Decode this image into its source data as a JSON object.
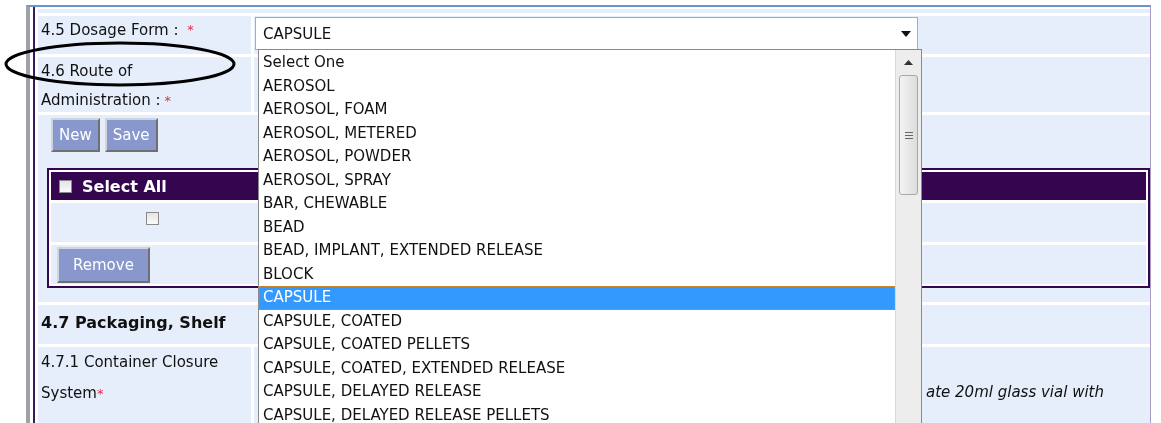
{
  "dosage_form": {
    "label": "4.5 Dosage Form :",
    "required_mark": "*",
    "value": "CAPSULE",
    "expanded": true,
    "options": [
      {
        "label": "Select One",
        "selected": false
      },
      {
        "label": "AEROSOL",
        "selected": false
      },
      {
        "label": "AEROSOL, FOAM",
        "selected": false
      },
      {
        "label": "AEROSOL, METERED",
        "selected": false
      },
      {
        "label": "AEROSOL, POWDER",
        "selected": false
      },
      {
        "label": "AEROSOL, SPRAY",
        "selected": false
      },
      {
        "label": "BAR, CHEWABLE",
        "selected": false
      },
      {
        "label": "BEAD",
        "selected": false
      },
      {
        "label": "BEAD, IMPLANT, EXTENDED RELEASE",
        "selected": false
      },
      {
        "label": "BLOCK",
        "selected": false
      },
      {
        "label": "CAPSULE",
        "selected": true
      },
      {
        "label": "CAPSULE, COATED",
        "selected": false
      },
      {
        "label": "CAPSULE, COATED PELLETS",
        "selected": false
      },
      {
        "label": "CAPSULE, COATED, EXTENDED RELEASE",
        "selected": false
      },
      {
        "label": "CAPSULE, DELAYED RELEASE",
        "selected": false
      },
      {
        "label": "CAPSULE, DELAYED RELEASE PELLETS",
        "selected": false
      }
    ]
  },
  "route": {
    "label_lines": [
      "4.6 Route of",
      "Administration :"
    ],
    "required_mark": "*"
  },
  "buttons": [
    {
      "label": "New"
    },
    {
      "label": "Save"
    }
  ],
  "table": {
    "header": {
      "label": "Select All",
      "checked": false
    },
    "rows": [
      {
        "kind": "checkbox",
        "checked": false
      },
      {
        "kind": "button",
        "label": "Remove"
      }
    ]
  },
  "section": {
    "title": "4.7 Packaging, Shelf"
  },
  "container_closure": {
    "label_lines": [
      "4.7.1 Container Closure",
      "System"
    ],
    "required_mark": "*",
    "value": "ate 20ml glass vial with"
  },
  "annotation": {
    "kind": "ellipse"
  }
}
